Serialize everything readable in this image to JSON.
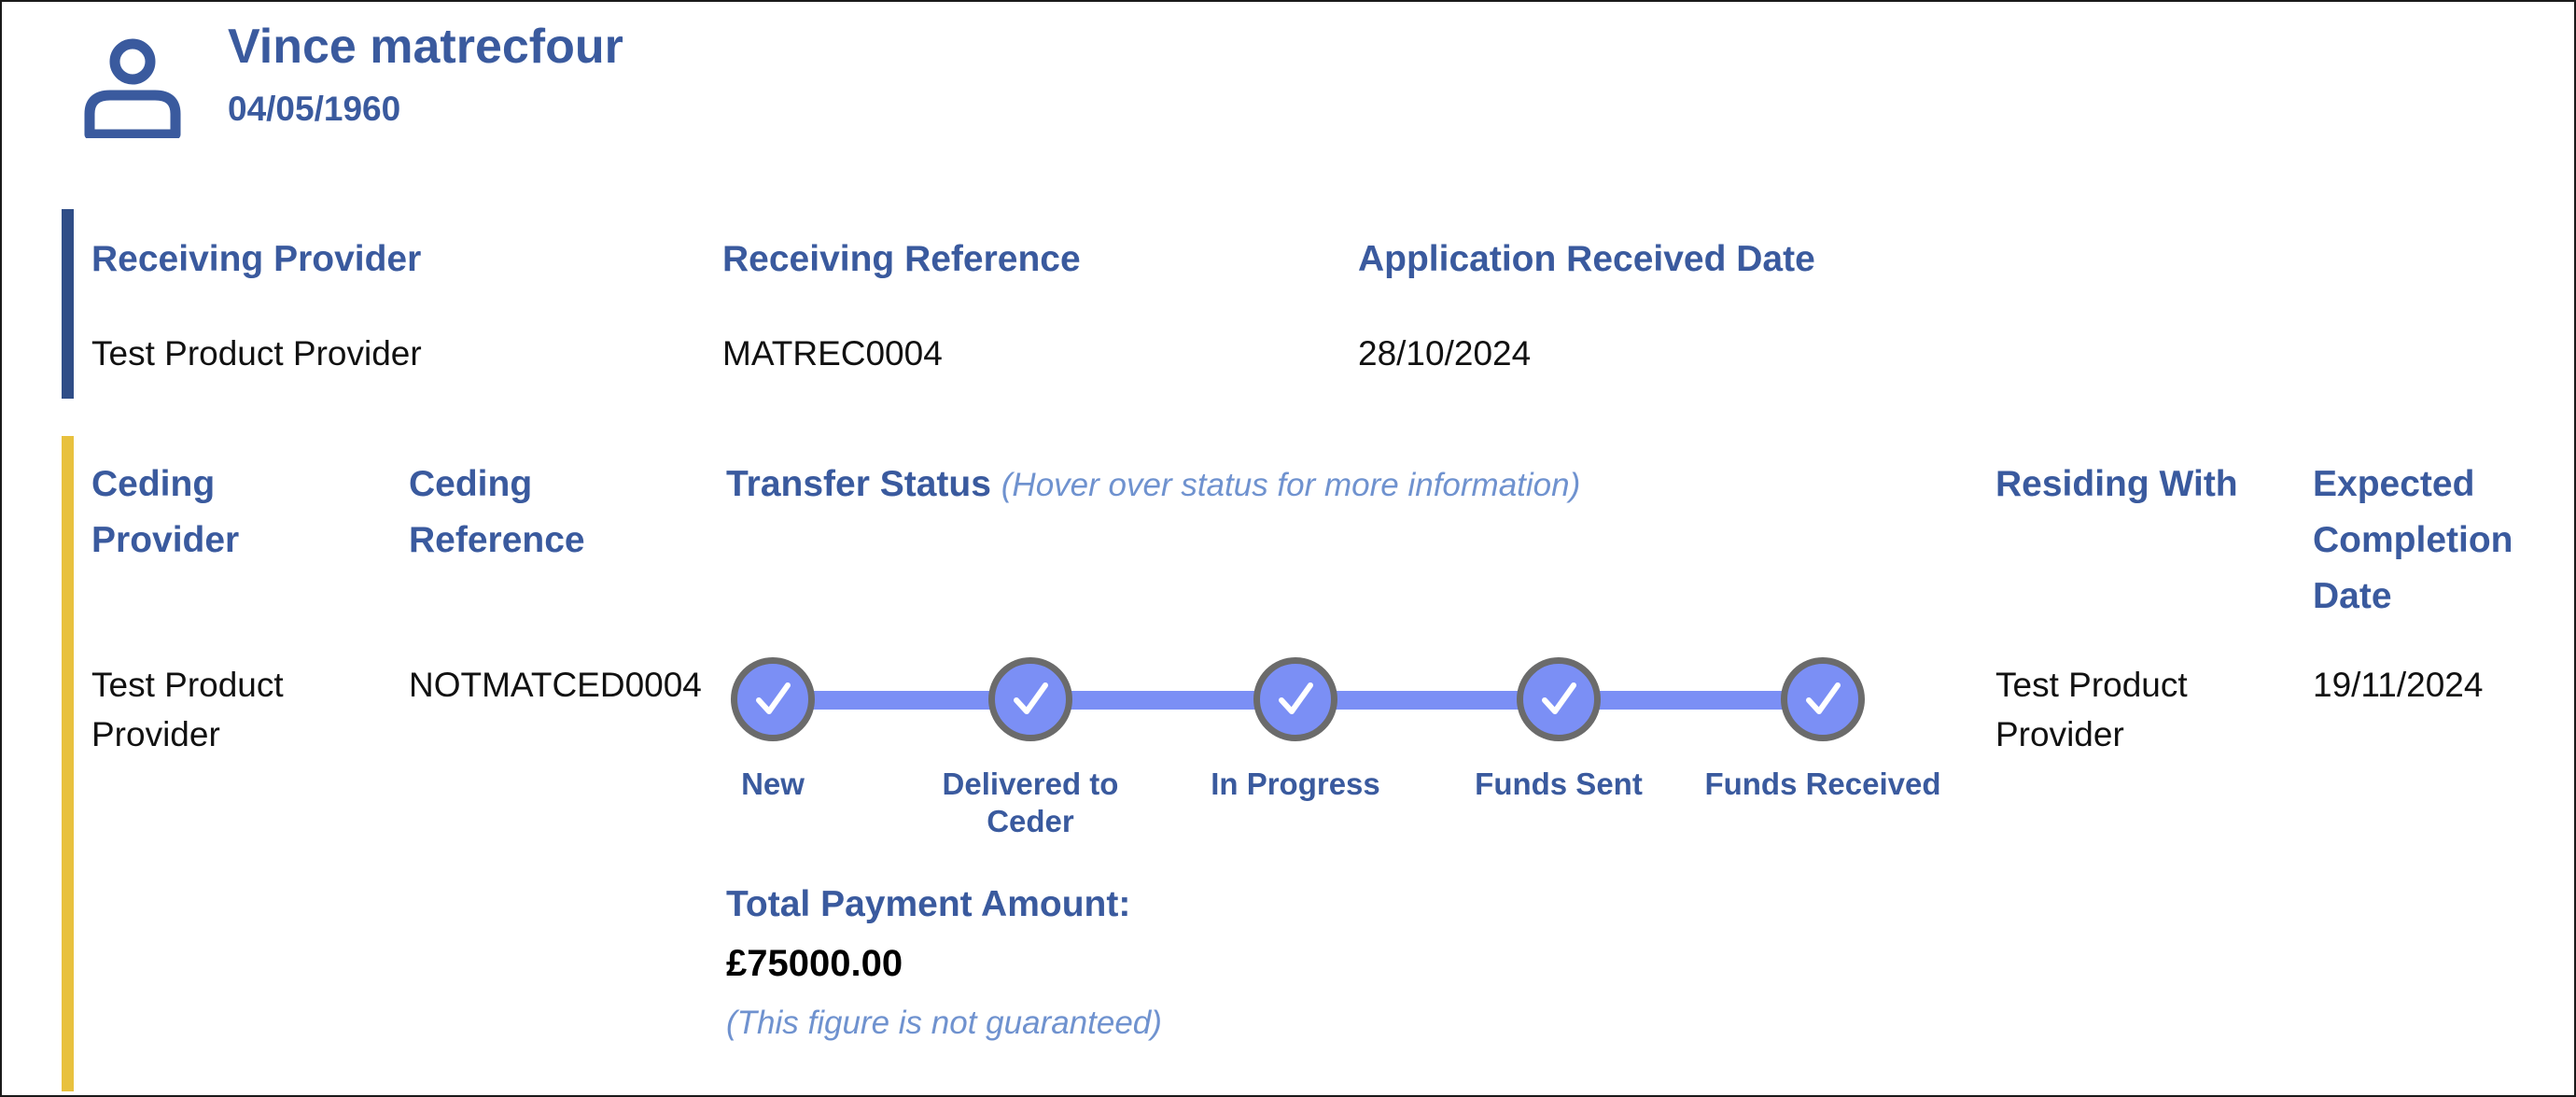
{
  "person": {
    "name": "Vince matrecfour",
    "dob": "04/05/1960",
    "icon": "person-icon"
  },
  "receiving": {
    "provider_label": "Receiving Provider",
    "provider_value": "Test Product Provider",
    "reference_label": "Receiving Reference",
    "reference_value": "MATREC0004",
    "date_label": "Application Received Date",
    "date_value": "28/10/2024"
  },
  "ceding": {
    "provider_label": "Ceding Provider",
    "provider_value": "Test Product Provider",
    "reference_label": "Ceding Reference",
    "reference_value": "NOTMATCED0004",
    "status_label": "Transfer Status",
    "status_hint": "(Hover over status for more information)",
    "residing_label": "Residing With",
    "residing_value": "Test Product Provider",
    "completion_label": "Expected Completion Date",
    "completion_value": "19/11/2024"
  },
  "steps": [
    {
      "label": "New",
      "completed": true
    },
    {
      "label": "Delivered to Ceder",
      "completed": true
    },
    {
      "label": "In Progress",
      "completed": true
    },
    {
      "label": "Funds Sent",
      "completed": true
    },
    {
      "label": "Funds Received",
      "completed": true
    }
  ],
  "payment": {
    "label": "Total Payment Amount:",
    "value": "£75000.00",
    "note": "(This figure is not guaranteed)"
  },
  "colors": {
    "heading": "#3a5a9e",
    "receiving_bar": "#2f4d87",
    "ceding_bar": "#e8c13e",
    "step_fill": "#7b8ff5",
    "hint": "#6f92cf"
  }
}
